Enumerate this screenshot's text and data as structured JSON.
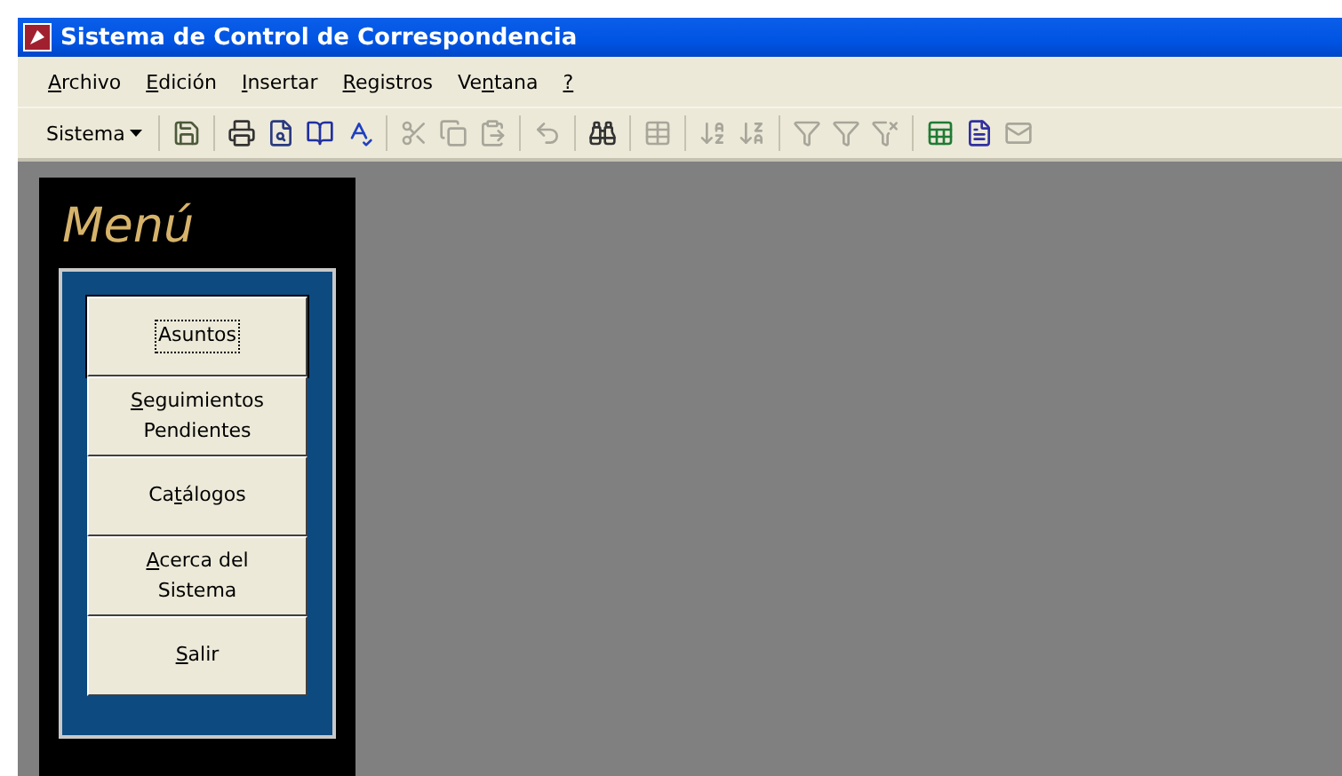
{
  "window": {
    "title": "Sistema de Control de Correspondencia"
  },
  "menu_bar": [
    {
      "label": {
        "key": "A",
        "post": "rchivo"
      }
    },
    {
      "label": {
        "key": "E",
        "post": "dición"
      }
    },
    {
      "label": {
        "key": "I",
        "post": "nsertar"
      }
    },
    {
      "label": {
        "key": "R",
        "post": "egistros"
      }
    },
    {
      "label": {
        "pre": "Ve",
        "key": "n",
        "post": "tana"
      }
    },
    {
      "label": {
        "key": "?"
      }
    }
  ],
  "toolbar": {
    "dropdown": "Sistema",
    "groups": [
      [
        {
          "kind": "save",
          "disabled": false
        }
      ],
      [
        {
          "kind": "print",
          "disabled": false
        },
        {
          "kind": "preview",
          "disabled": false
        },
        {
          "kind": "book",
          "disabled": false
        },
        {
          "kind": "spell",
          "disabled": false
        }
      ],
      [
        {
          "kind": "cut",
          "disabled": true
        },
        {
          "kind": "copy",
          "disabled": true
        },
        {
          "kind": "paste",
          "disabled": true
        }
      ],
      [
        {
          "kind": "undo",
          "disabled": true
        }
      ],
      [
        {
          "kind": "find",
          "disabled": false
        }
      ],
      [
        {
          "kind": "table",
          "disabled": true
        }
      ],
      [
        {
          "kind": "sort-asc",
          "disabled": true
        },
        {
          "kind": "sort-desc",
          "disabled": true
        }
      ],
      [
        {
          "kind": "filter-selection",
          "disabled": true
        },
        {
          "kind": "filter",
          "disabled": true
        },
        {
          "kind": "filter-remove",
          "disabled": true
        }
      ],
      [
        {
          "kind": "excel",
          "disabled": false
        },
        {
          "kind": "word",
          "disabled": false
        },
        {
          "kind": "mail",
          "disabled": true
        }
      ]
    ]
  },
  "menu_form": {
    "title": "Menú",
    "buttons": [
      {
        "label": {
          "pre": "Asuntos"
        },
        "focused": true
      },
      {
        "label": {
          "key": "S",
          "post": "eguimientos Pendientes"
        },
        "focused": false
      },
      {
        "label": {
          "pre": "Ca",
          "key": "t",
          "post": "álogos"
        },
        "focused": false
      },
      {
        "label": {
          "key": "A",
          "post": "cerca del Sistema"
        },
        "focused": false
      },
      {
        "label": {
          "key": "S",
          "post": "alir"
        },
        "focused": false
      }
    ]
  }
}
